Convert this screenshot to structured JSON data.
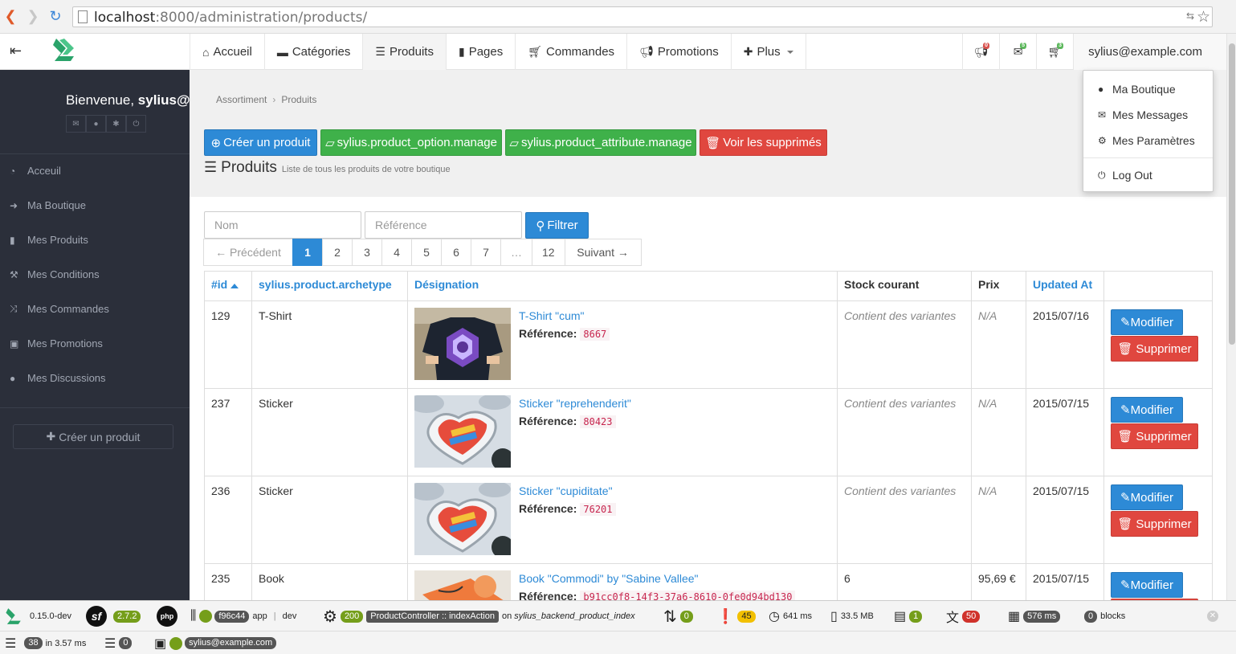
{
  "browser": {
    "url_host": "localhost",
    "url_rest": ":8000/administration/products/"
  },
  "topnav": {
    "items": [
      {
        "label": "Accueil",
        "icon": "home-icon"
      },
      {
        "label": "Catégories",
        "icon": "folder-icon"
      },
      {
        "label": "Produits",
        "icon": "list-icon"
      },
      {
        "label": "Pages",
        "icon": "file-icon"
      },
      {
        "label": "Commandes",
        "icon": "cart-icon"
      },
      {
        "label": "Promotions",
        "icon": "bullhorn-icon"
      },
      {
        "label": "Plus",
        "icon": "plus-icon"
      }
    ],
    "notifications": [
      {
        "icon": "bullhorn-icon",
        "count": "0",
        "color": "#d9534f"
      },
      {
        "icon": "envelope-icon",
        "count": "5",
        "color": "#5cb85c"
      },
      {
        "icon": "cart-icon",
        "count": "3",
        "color": "#5cb85c"
      }
    ],
    "user": "sylius@example.com"
  },
  "dropdown": {
    "items": [
      {
        "label": "Ma Boutique",
        "icon": "user-icon"
      },
      {
        "label": "Mes Messages",
        "icon": "envelope-icon"
      },
      {
        "label": "Mes Paramètres",
        "icon": "gears-icon"
      },
      {
        "label": "Log Out",
        "icon": "power-icon"
      }
    ]
  },
  "sidebar": {
    "welcome_prefix": "Bienvenue, ",
    "welcome_user": "sylius@example.com",
    "items": [
      {
        "label": "Acceuil",
        "icon": "dashboard-icon"
      },
      {
        "label": "Ma Boutique",
        "icon": "sign-in-icon"
      },
      {
        "label": "Mes Produits",
        "icon": "bookmark-icon"
      },
      {
        "label": "Mes Conditions",
        "icon": "gavel-icon"
      },
      {
        "label": "Mes Commandes",
        "icon": "random-icon"
      },
      {
        "label": "Mes Promotions",
        "icon": "money-icon"
      },
      {
        "label": "Mes Discussions",
        "icon": "comment-icon"
      }
    ],
    "create_label": "Créer un produit"
  },
  "breadcrumb": [
    "Assortiment",
    "Produits"
  ],
  "actions": {
    "create": "Créer un produit",
    "option_manage": "sylius.product_option.manage",
    "attribute_manage": "sylius.product_attribute.manage",
    "show_deleted": "Voir les supprimés"
  },
  "page": {
    "title": "Produits",
    "subtitle": "Liste de tous les produits de votre boutique"
  },
  "filter": {
    "name_placeholder": "Nom",
    "ref_placeholder": "Référence",
    "button": "Filtrer"
  },
  "pagination": {
    "prev": "← Précédent",
    "pages": [
      "1",
      "2",
      "3",
      "4",
      "5",
      "6",
      "7",
      "…",
      "12"
    ],
    "next": "Suivant →",
    "current": "1"
  },
  "table": {
    "headers": {
      "id": "#id",
      "archetype": "sylius.product.archetype",
      "designation": "Désignation",
      "stock": "Stock courant",
      "price": "Prix",
      "updated": "Updated At"
    },
    "ref_label": "Référence:",
    "edit_label": "Modifier",
    "delete_label": "Supprimer",
    "rows": [
      {
        "id": "129",
        "archetype": "T-Shirt",
        "name": "T-Shirt \"cum\"",
        "ref": "8667",
        "stock": "Contient des variantes",
        "price": "N/A",
        "updated": "2015/07/16",
        "image": "tshirt"
      },
      {
        "id": "237",
        "archetype": "Sticker",
        "name": "Sticker \"reprehenderit\"",
        "ref": "80423",
        "stock": "Contient des variantes",
        "price": "N/A",
        "updated": "2015/07/15",
        "image": "sticker"
      },
      {
        "id": "236",
        "archetype": "Sticker",
        "name": "Sticker \"cupiditate\"",
        "ref": "76201",
        "stock": "Contient des variantes",
        "price": "N/A",
        "updated": "2015/07/15",
        "image": "sticker"
      },
      {
        "id": "235",
        "archetype": "Book",
        "name": "Book \"Commodi\" by \"Sabine Vallee\"",
        "ref": "b91cc0f8-14f3-37a6-8610-0fe0d94bd130",
        "stock": "6",
        "price": "95,69 €",
        "updated": "2015/07/15",
        "image": "book"
      }
    ]
  },
  "debug": {
    "sylius_version": "0.15.0-dev",
    "symfony_version": "2.7.2",
    "token": "f96c44",
    "app": "app",
    "env": "dev",
    "status": "200",
    "controller": "ProductController :: indexAction",
    "route_prefix": "on",
    "route": "sylius_backend_product_index",
    "redirects": "0",
    "errors": "45",
    "time": "641 ms",
    "memory": "33.5 MB",
    "forms": "1",
    "translations": "50",
    "render_time": "576 ms",
    "blocks_count": "0",
    "blocks_label": "blocks",
    "queries": "38",
    "queries_time": "in 3.57 ms",
    "cache": "0",
    "user": "sylius@example.com"
  }
}
